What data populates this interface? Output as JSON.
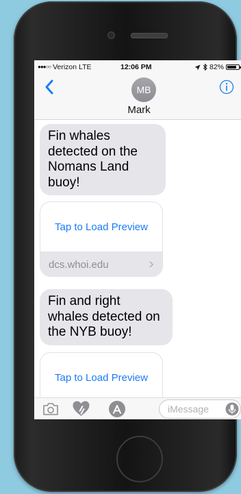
{
  "status_bar": {
    "carrier": "Verizon",
    "network": "LTE",
    "time": "12:06 PM",
    "battery": "82%",
    "battery_level": 0.82
  },
  "header": {
    "avatar_initials": "MB",
    "contact_name": "Mark",
    "back_icon": "chevron-left-icon",
    "info_icon": "info-circle-icon"
  },
  "messages": [
    {
      "type": "text",
      "text": "Fin whales detected on the Nomans Land buoy!"
    },
    {
      "type": "link",
      "action": "Tap to Load Preview",
      "domain": "dcs.whoi.edu"
    },
    {
      "type": "text",
      "text": "Fin and right whales detected on the NYB buoy!"
    },
    {
      "type": "link",
      "action": "Tap to Load Preview"
    }
  ],
  "input_bar": {
    "placeholder": "iMessage",
    "icons": [
      "camera-icon",
      "digital-touch-heart-icon",
      "app-store-icon",
      "microphone-icon"
    ]
  },
  "colors": {
    "background": "#8fcbe0",
    "ios_blue": "#1b7cf5",
    "bubble_gray": "#e5e5ea"
  }
}
